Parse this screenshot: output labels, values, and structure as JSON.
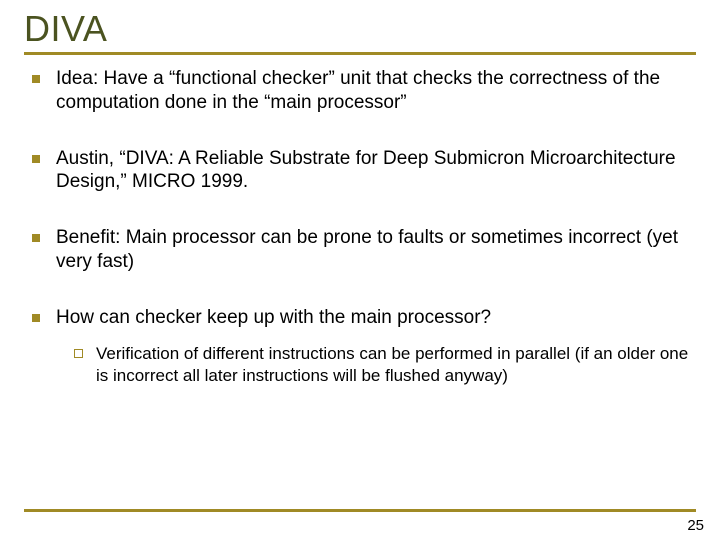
{
  "title": "DIVA",
  "bullets": [
    {
      "text": "Idea: Have a “functional checker” unit that checks the correctness of the computation done in the “main processor”"
    },
    {
      "text": "Austin, “DIVA: A Reliable Substrate for Deep Submicron Microarchitecture Design,” MICRO 1999."
    },
    {
      "text": "Benefit: Main processor can be prone to faults or sometimes incorrect (yet very fast)"
    },
    {
      "text": "How can checker keep up with the main processor?",
      "sub": [
        {
          "text": "Verification of different instructions can be performed in parallel (if an older one is incorrect all later instructions will be flushed anyway)"
        }
      ]
    }
  ],
  "page_number": "25"
}
